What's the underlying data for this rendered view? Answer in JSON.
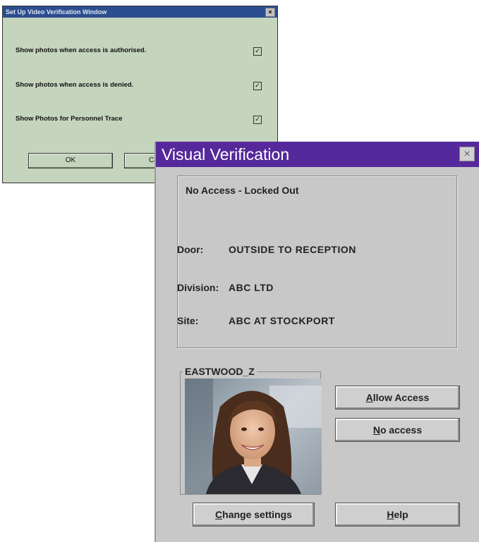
{
  "setup_dialog": {
    "title": "Set Up Video Verification Window",
    "close_glyph": "×",
    "options": [
      {
        "label": "Show photos when access is authorised.",
        "checked": true
      },
      {
        "label": "Show photos when access is denied.",
        "checked": true
      },
      {
        "label": "Show Photos for Personnel Trace",
        "checked": true
      }
    ],
    "ok_label": "OK",
    "cancel_label": "Cancel"
  },
  "verify_dialog": {
    "title": "Visual Verification",
    "close_glyph": "×",
    "status": "No Access - Locked Out",
    "door_label": "Door:",
    "door_value": "OUTSIDE TO RECEPTION",
    "division_label": "Division:",
    "division_value": "ABC LTD",
    "site_label": "Site:",
    "site_value": "ABC AT STOCKPORT",
    "person_name": "EASTWOOD_Z",
    "allow_access": {
      "mnemonic": "A",
      "rest": "llow Access"
    },
    "no_access": {
      "mnemonic": "N",
      "rest": "o access"
    },
    "change_settings": {
      "mnemonic": "C",
      "rest": "hange settings"
    },
    "help": {
      "mnemonic": "H",
      "rest": "elp"
    }
  },
  "colors": {
    "setup_bg": "#c5d4bd",
    "setup_title": "#2c4e8f",
    "verify_title": "#55299b",
    "verify_bg": "#c8c8c8"
  }
}
